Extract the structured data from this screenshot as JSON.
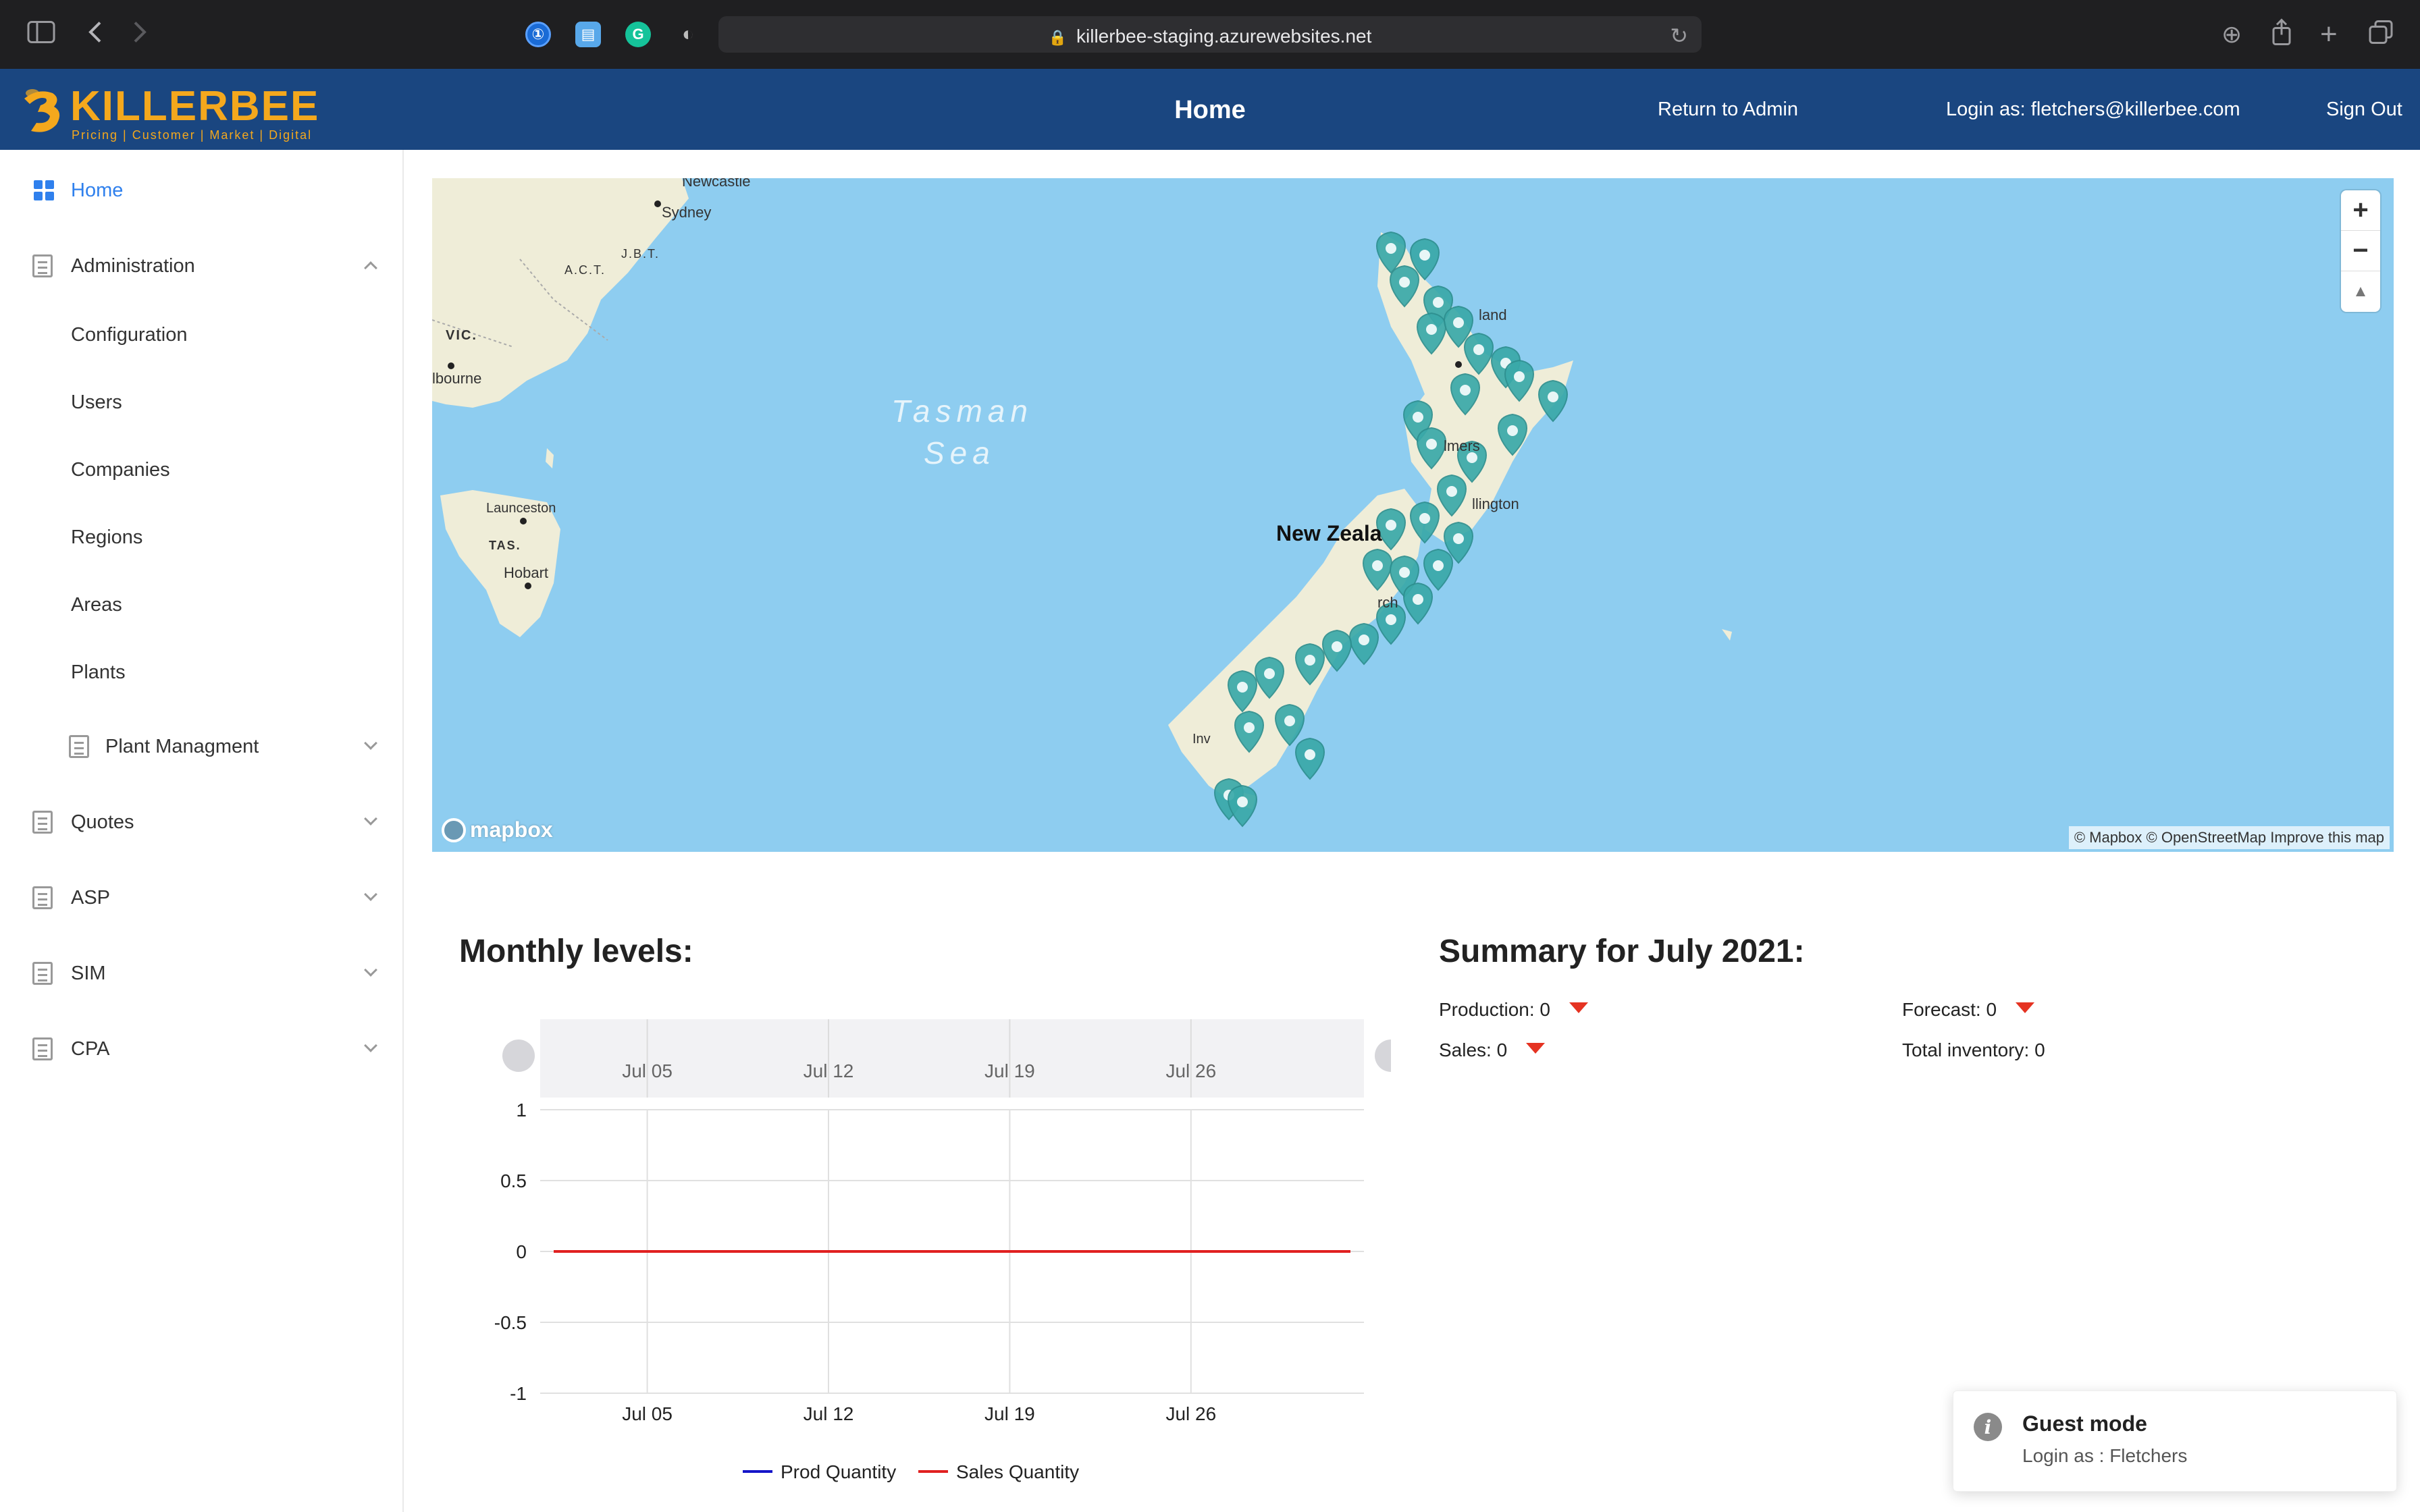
{
  "browser": {
    "url": "killerbee-staging.azurewebsites.net"
  },
  "header": {
    "brand": "KILLERBEE",
    "tagline": "Pricing | Customer | Market | Digital",
    "title": "Home",
    "return_admin": "Return to Admin",
    "login_as": "Login as: fletchers@killerbee.com",
    "sign_out": "Sign Out",
    "bg_color": "#1a4680",
    "brand_color": "#f4a81d"
  },
  "sidebar": {
    "home": "Home",
    "administration": "Administration",
    "admin_items": [
      "Configuration",
      "Users",
      "Companies",
      "Regions",
      "Areas",
      "Plants"
    ],
    "plant_management": "Plant Managment",
    "quotes": "Quotes",
    "asp": "ASP",
    "sim": "SIM",
    "cpa": "CPA",
    "active_color": "#2f80ed"
  },
  "map": {
    "labels": {
      "newcastle": "Newcastle",
      "sydney": "Sydney",
      "jbt": "J.B.T.",
      "act": "A.C.T.",
      "vic": "VIC.",
      "melbourne": "lbourne",
      "tasman": "Tasman",
      "sea": "Sea",
      "launceston": "Launceston",
      "tas": "TAS.",
      "hobart": "Hobart",
      "newzealand": "New Zeala",
      "wellington": "llington",
      "christchurch": "rch",
      "auckland": "land",
      "palmerston": "lmers",
      "invercargill": "Inv"
    },
    "zoom_in": "+",
    "zoom_out": "−",
    "compass": "▲",
    "mapbox": "mapbox",
    "attribution": "© Mapbox © OpenStreetMap Improve this map",
    "water_color": "#8ecdf0",
    "land_color": "#efedd8",
    "marker_color": "#3aa9a9"
  },
  "monthly": {
    "title": "Monthly levels:"
  },
  "chart_data": {
    "type": "line",
    "x": [
      "Jul 01",
      "Jul 05",
      "Jul 12",
      "Jul 19",
      "Jul 26",
      "Jul 31"
    ],
    "x_ticks": [
      "Jul 05",
      "Jul 12",
      "Jul 19",
      "Jul 26"
    ],
    "y_ticks": [
      "1",
      "0.5",
      "0",
      "-0.5",
      "-1"
    ],
    "ylim": [
      -1,
      1
    ],
    "series": [
      {
        "name": "Prod Quantity",
        "color": "#1515c8",
        "values": [
          0,
          0,
          0,
          0,
          0,
          0
        ]
      },
      {
        "name": "Sales Quantity",
        "color": "#e02020",
        "values": [
          0,
          0,
          0,
          0,
          0,
          0
        ]
      }
    ],
    "grid": true,
    "legend": "bottom-center",
    "navigator": true
  },
  "summary": {
    "title": "Summary for July 2021:",
    "production": "Production: 0",
    "forecast": "Forecast: 0",
    "sales": "Sales: 0",
    "total_inventory": "Total inventory: 0",
    "indicator_color": "#e53322"
  },
  "toast": {
    "icon": "i",
    "title": "Guest mode",
    "message": "Login as : Fletchers"
  }
}
